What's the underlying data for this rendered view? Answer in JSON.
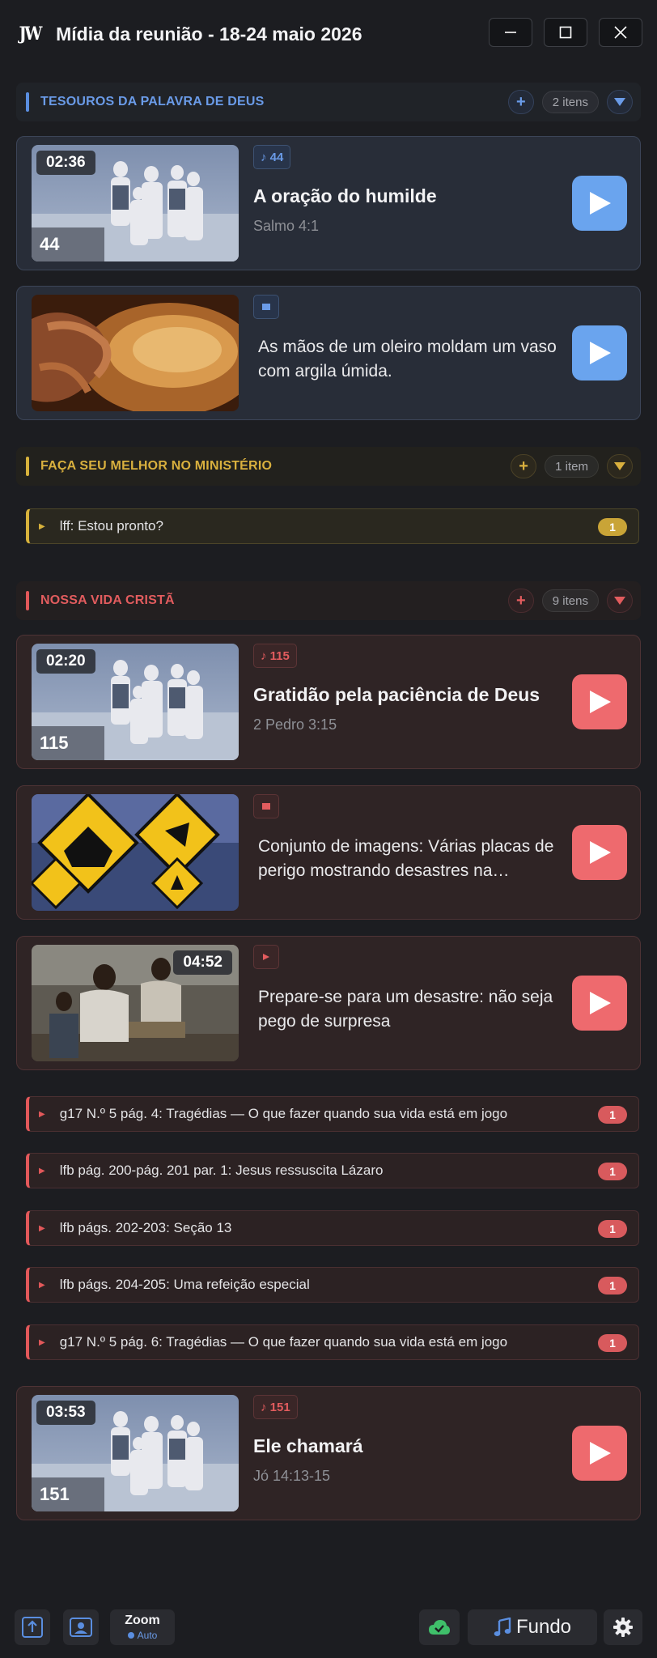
{
  "window": {
    "logo": "JW",
    "title": "Mídia da reunião - 18-24 maio 2026"
  },
  "sections": [
    {
      "title": "TESOUROS DA PALAVRA DE DEUS",
      "count": "2 itens",
      "color": "#5a8ee0",
      "items": [
        {
          "kind": "song",
          "duration": "02:36",
          "number": "44",
          "tag": "♪ 44",
          "title": "A oração do humilde",
          "subtitle": "Salmo 4:1"
        },
        {
          "kind": "image",
          "description": "As mãos de um oleiro moldam um vaso com argila úmida."
        }
      ]
    },
    {
      "title": "FAÇA SEU MELHOR NO MINISTÉRIO",
      "count": "1 item",
      "color": "#d7b23c",
      "rows": [
        {
          "label": "lff: Estou pronto?",
          "badge": "1"
        }
      ]
    },
    {
      "title": "NOSSA VIDA CRISTÃ",
      "count": "9 itens",
      "color": "#e2585a",
      "items": [
        {
          "kind": "song",
          "duration": "02:20",
          "number": "115",
          "tag": "♪ 115",
          "title": "Gratidão pela paciência de Deus",
          "subtitle": "2 Pedro 3:15"
        },
        {
          "kind": "image",
          "description": "Conjunto de imagens: Várias placas de perigo mostrando desastres na…"
        },
        {
          "kind": "video",
          "duration": "04:52",
          "description": "Prepare-se para um desastre: não seja pego de surpresa"
        }
      ],
      "rows": [
        {
          "label": "g17 N.º 5 pág. 4: Tragédias — O que fazer quando sua vida está em jogo",
          "badge": "1"
        },
        {
          "label": "lfb pág. 200-pág. 201 par. 1: Jesus ressuscita Lázaro",
          "badge": "1"
        },
        {
          "label": "lfb págs. 202-203: Seção 13",
          "badge": "1"
        },
        {
          "label": "lfb págs. 204-205: Uma refeição especial",
          "badge": "1"
        },
        {
          "label": "g17 N.º 5 pág. 6: Tragédias — O que fazer quando sua vida está em jogo",
          "badge": "1"
        }
      ],
      "closing": {
        "kind": "song",
        "duration": "03:53",
        "number": "151",
        "tag": "♪ 151",
        "title": "Ele chamará",
        "subtitle": "Jó 14:13-15"
      }
    }
  ],
  "bottom_bar": {
    "zoom_label": "Zoom",
    "zoom_mode": "Auto",
    "background_label": "Fundo",
    "icons": [
      "upload-icon",
      "camera-icon",
      "cloud-check-icon",
      "music-note-icon",
      "gear-icon"
    ]
  }
}
